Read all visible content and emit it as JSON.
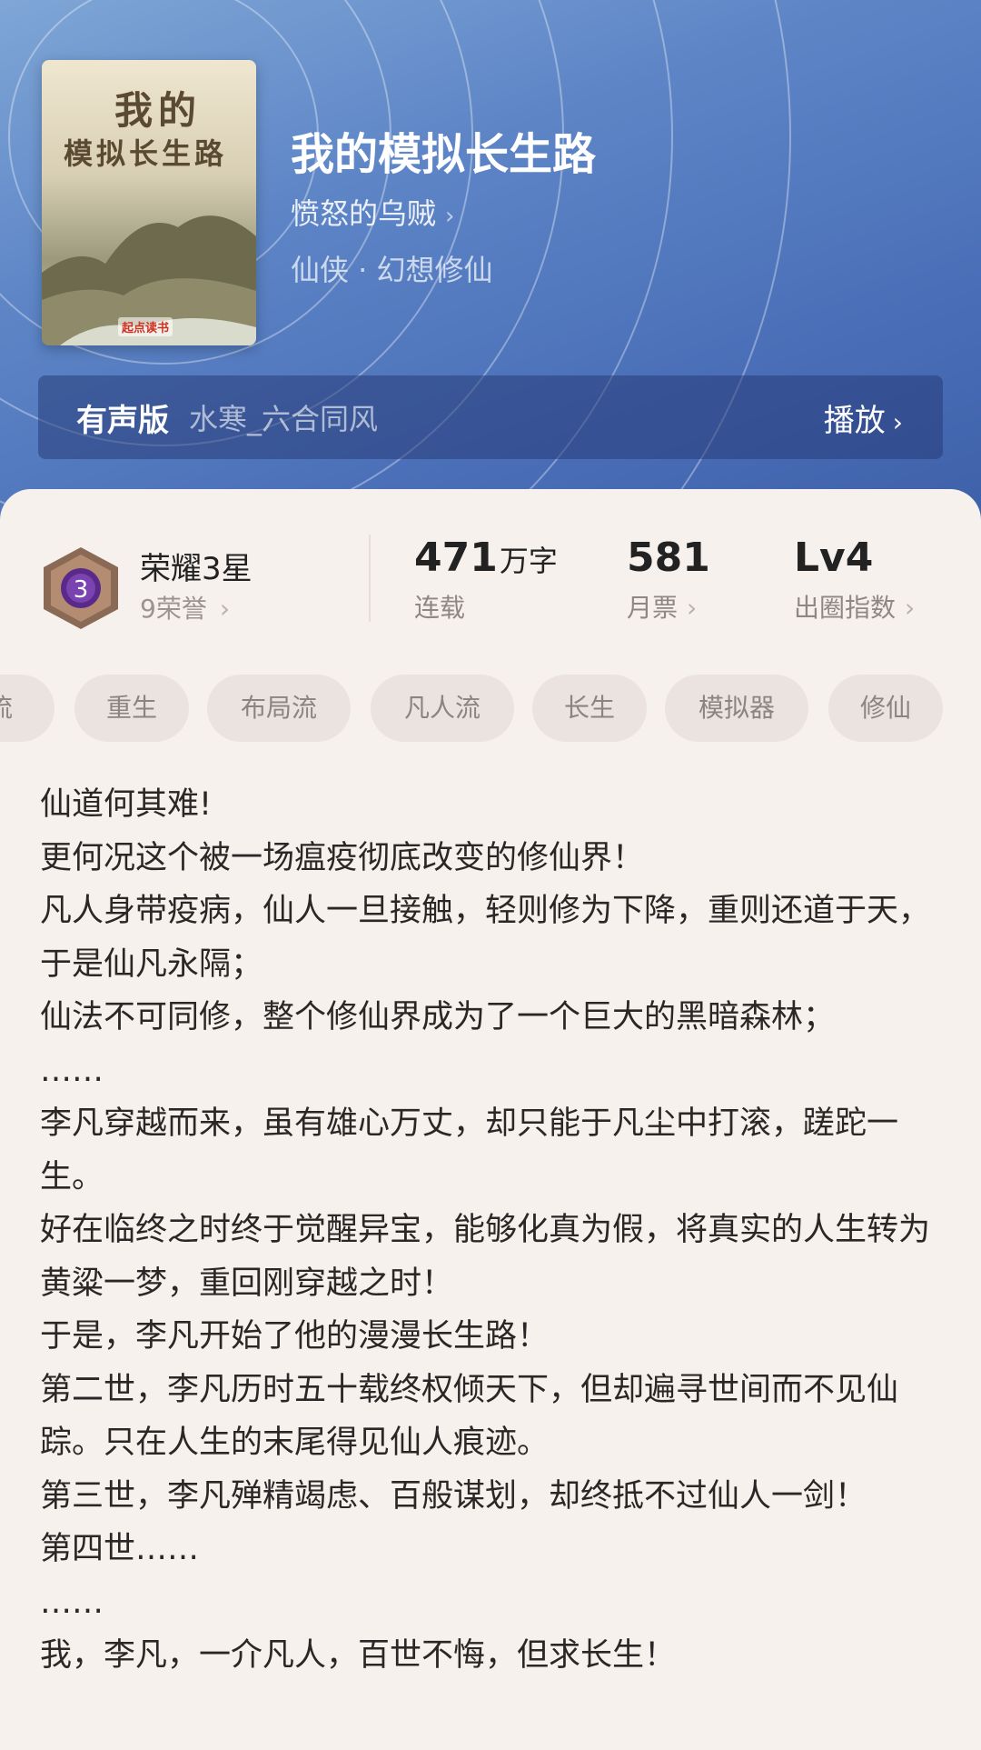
{
  "book": {
    "title": "我的模拟长生路",
    "author": "愤怒的乌贼",
    "genre": "仙侠 · 幻想修仙",
    "cover_title_line1": "我的",
    "cover_title_line2": "模拟长生路",
    "cover_publisher": "起点读书"
  },
  "audio": {
    "label": "有声版",
    "narrator": "水寒_六合同风",
    "play_label": "播放"
  },
  "stats": {
    "honor_title": "荣耀3星",
    "honor_sub": "9荣誉",
    "badge_level": "3",
    "words_value": "471",
    "words_unit": "万字",
    "words_label": "连载",
    "votes_value": "581",
    "votes_label": "月票",
    "level_value": "Lv4",
    "level_label": "出圈指数"
  },
  "tags": [
    "流",
    "重生",
    "布局流",
    "凡人流",
    "长生",
    "模拟器",
    "修仙"
  ],
  "synopsis": [
    "仙道何其难!",
    "更何况这个被一场瘟疫彻底改变的修仙界！",
    "凡人身带疫病，仙人一旦接触，轻则修为下降，重则还道于天，于是仙凡永隔；",
    "仙法不可同修，整个修仙界成为了一个巨大的黑暗森林；",
    "……",
    "李凡穿越而来，虽有雄心万丈，却只能于凡尘中打滚，蹉跎一生。",
    "好在临终之时终于觉醒异宝，能够化真为假，将真实的人生转为黄粱一梦，重回刚穿越之时！",
    "于是，李凡开始了他的漫漫长生路！",
    "第二世，李凡历时五十载终权倾天下，但却遍寻世间而不见仙踪。只在人生的末尾得见仙人痕迹。",
    "第三世，李凡殚精竭虑、百般谋划，却终抵不过仙人一剑！",
    "第四世……",
    "……",
    "我，李凡，一介凡人，百世不悔，但求长生！"
  ],
  "colors": {
    "hero_top": "#7fa6d6",
    "hero_bottom": "#3d5fa8",
    "card_bg": "#f7f1ee",
    "tag_bg": "#ebe3e0",
    "badge_purple": "#5a2a8a",
    "badge_bronze": "#8a6a55"
  },
  "icons": {
    "author_chevron": "chevron-right-icon",
    "play_chevron": "chevron-right-icon",
    "honor_badge": "honor-badge-icon"
  }
}
